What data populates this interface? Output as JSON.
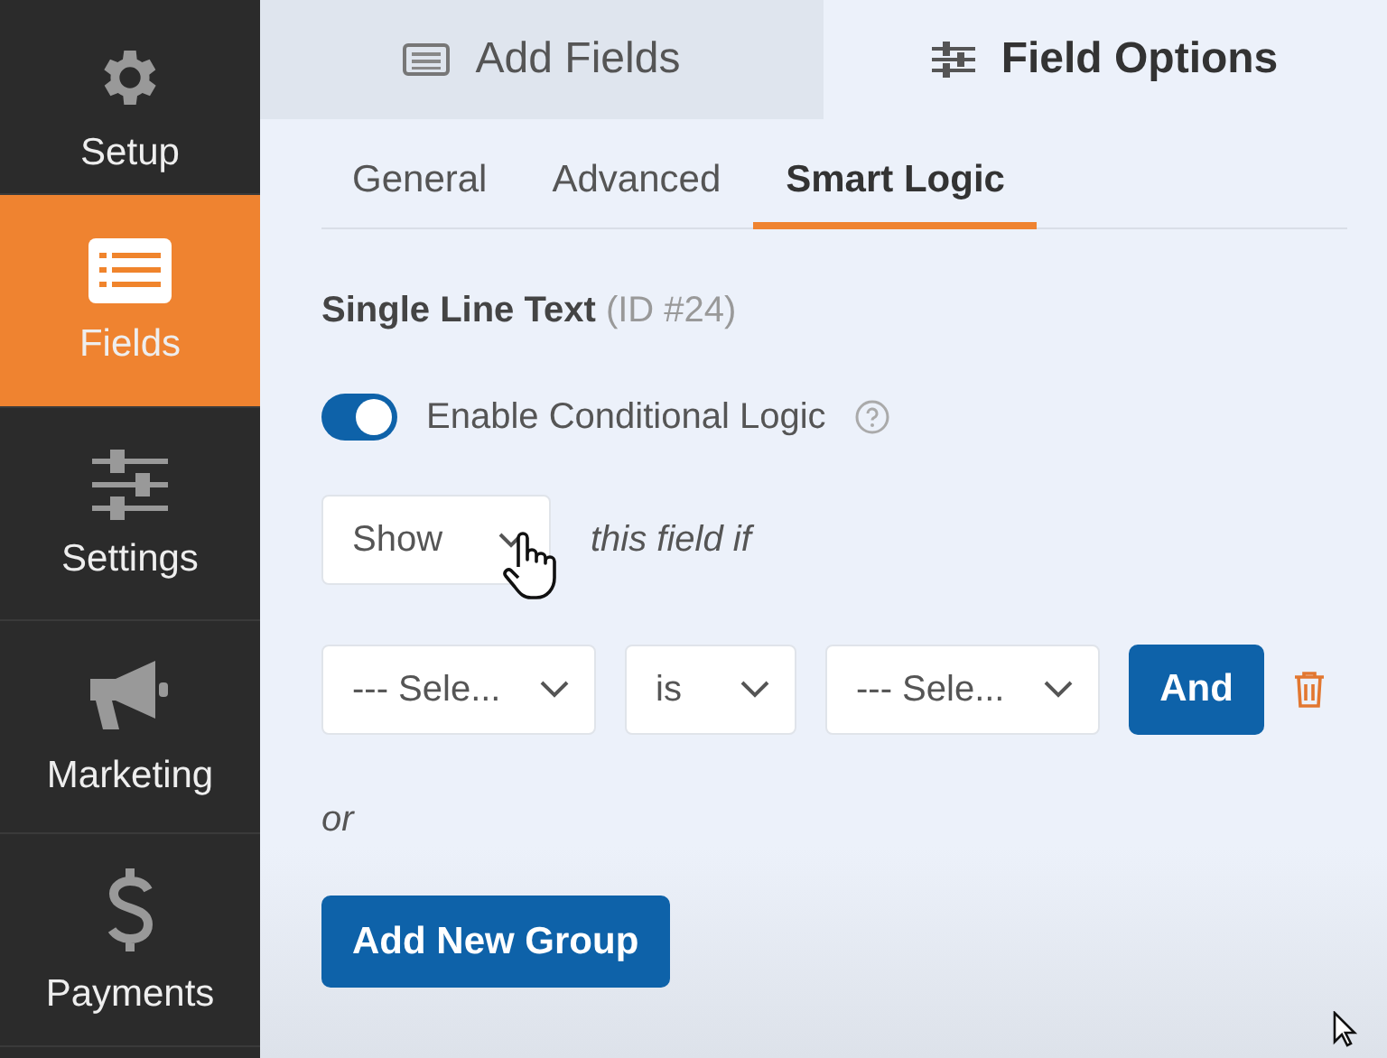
{
  "sidebar": {
    "items": [
      {
        "label": "Setup",
        "selected": false
      },
      {
        "label": "Fields",
        "selected": true
      },
      {
        "label": "Settings",
        "selected": false
      },
      {
        "label": "Marketing",
        "selected": false
      },
      {
        "label": "Payments",
        "selected": false
      }
    ]
  },
  "tabs": [
    {
      "label": "Add Fields",
      "selected": false
    },
    {
      "label": "Field Options",
      "selected": true
    }
  ],
  "subtabs": [
    {
      "label": "General",
      "selected": false
    },
    {
      "label": "Advanced",
      "selected": false
    },
    {
      "label": "Smart Logic",
      "selected": true
    }
  ],
  "field": {
    "title": "Single Line Text",
    "id": "(ID #24)"
  },
  "toggle": {
    "label": "Enable Conditional Logic",
    "on": true
  },
  "action": {
    "value": "Show",
    "suffix": "this field if"
  },
  "rule": {
    "field": "--- Sele...",
    "operator": "is",
    "value": "--- Sele...",
    "and_button": "And"
  },
  "or_label": "or",
  "add_group_button": "Add New Group"
}
